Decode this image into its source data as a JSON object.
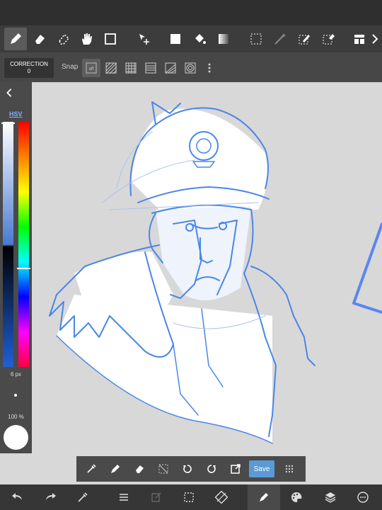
{
  "toolbar": {
    "tools": [
      {
        "name": "pen-icon",
        "active": true
      },
      {
        "name": "eraser-icon",
        "active": false
      },
      {
        "name": "blur-eraser-icon",
        "active": false
      },
      {
        "name": "hand-icon",
        "active": false
      },
      {
        "name": "rectangle-icon",
        "active": false
      },
      {
        "name": "move-select-icon",
        "active": false
      },
      {
        "name": "fill-color-icon",
        "active": false
      },
      {
        "name": "bucket-icon",
        "active": false
      },
      {
        "name": "gradient-icon",
        "active": false
      },
      {
        "name": "select-rect-icon",
        "active": false
      },
      {
        "name": "magic-wand-icon",
        "active": false
      },
      {
        "name": "select-pen-icon",
        "active": false
      },
      {
        "name": "select-eraser-icon",
        "active": false
      },
      {
        "name": "frame-icon",
        "active": false
      },
      {
        "name": "more-right-icon",
        "active": false
      }
    ]
  },
  "subtoolbar": {
    "correction_title": "CORRECTION",
    "correction_value": "0",
    "snap_label": "Snap",
    "snap_off": "off"
  },
  "left_panel": {
    "hsv_label": "HSV",
    "brush_size": "6 px",
    "opacity": "100 %",
    "current_color": "#ffffff"
  },
  "bottom_toolbar": {
    "save_label": "Save"
  },
  "colors": {
    "accent": "#5a9ad6",
    "sketch": "#4a86e8"
  }
}
